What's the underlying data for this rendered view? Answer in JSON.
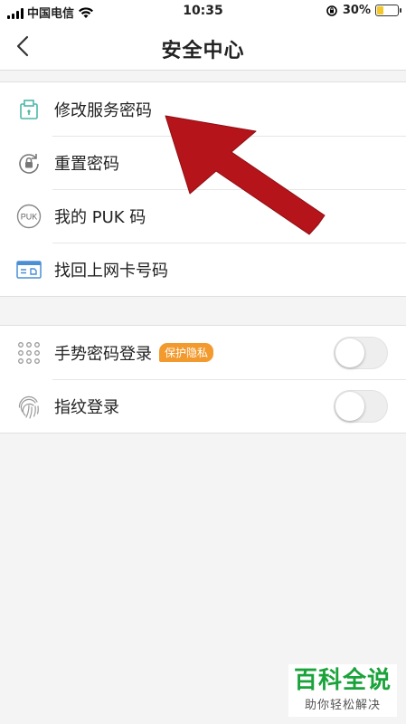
{
  "status_bar": {
    "carrier": "中国电信",
    "time": "10:35",
    "battery_percent": "30%",
    "battery_level": 0.3
  },
  "nav": {
    "title": "安全中心",
    "back_icon": "chevron-left-icon"
  },
  "group1": {
    "items": [
      {
        "label": "修改服务密码",
        "icon": "lock-box-icon"
      },
      {
        "label": "重置密码",
        "icon": "reset-lock-icon"
      },
      {
        "label": "我的 PUK 码",
        "icon": "puk-icon"
      },
      {
        "label": "找回上网卡号码",
        "icon": "card-icon"
      }
    ]
  },
  "group2": {
    "items": [
      {
        "label": "手势密码登录",
        "badge": "保护隐私",
        "icon": "gesture-grid-icon",
        "toggle_on": false
      },
      {
        "label": "指纹登录",
        "icon": "fingerprint-icon",
        "toggle_on": false
      }
    ]
  },
  "icons": {
    "puk_text": "PUK"
  },
  "watermark": {
    "title": "百科全说",
    "subtitle": "助你轻松解决"
  },
  "colors": {
    "arrow": "#b5141a",
    "badge": "#f29a2e",
    "watermark_green": "#1aa33a",
    "icon_teal": "#4bb7a8"
  }
}
